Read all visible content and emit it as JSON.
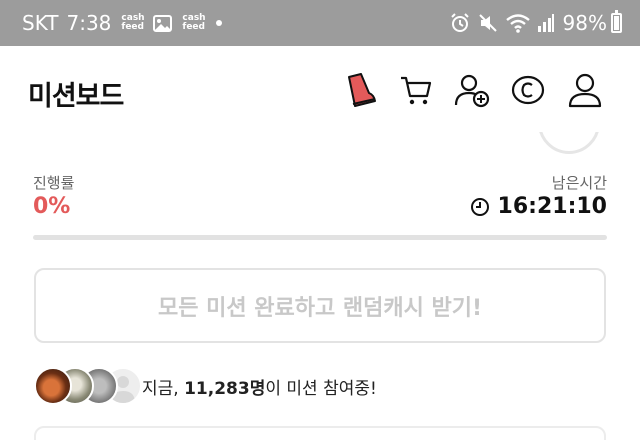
{
  "status_bar": {
    "carrier": "SKT",
    "time": "7:38",
    "badges": [
      "cash feed",
      "cash feed"
    ],
    "battery": "98%",
    "icons": [
      "gallery-icon",
      "alarm-icon",
      "mute-icon",
      "wifi-icon",
      "signal-icon",
      "battery-icon"
    ]
  },
  "header": {
    "title": "미션보드",
    "icons": [
      "shoe-icon",
      "cart-icon",
      "add-friend-icon",
      "coin-icon",
      "profile-icon"
    ]
  },
  "progress": {
    "label": "진행률",
    "value": "0%",
    "fraction": 0
  },
  "remaining": {
    "label": "남은시간",
    "time": "16:21:10"
  },
  "cta": {
    "label": "모든 미션 완료하고 랜덤캐시 받기!"
  },
  "participants": {
    "prefix": "지금, ",
    "count": "11,283명",
    "suffix": "이 미션 참여중!"
  },
  "colors": {
    "accent": "#e35a5a",
    "status_bar": "#9c9c9c",
    "muted_text": "#c8c8c8"
  }
}
